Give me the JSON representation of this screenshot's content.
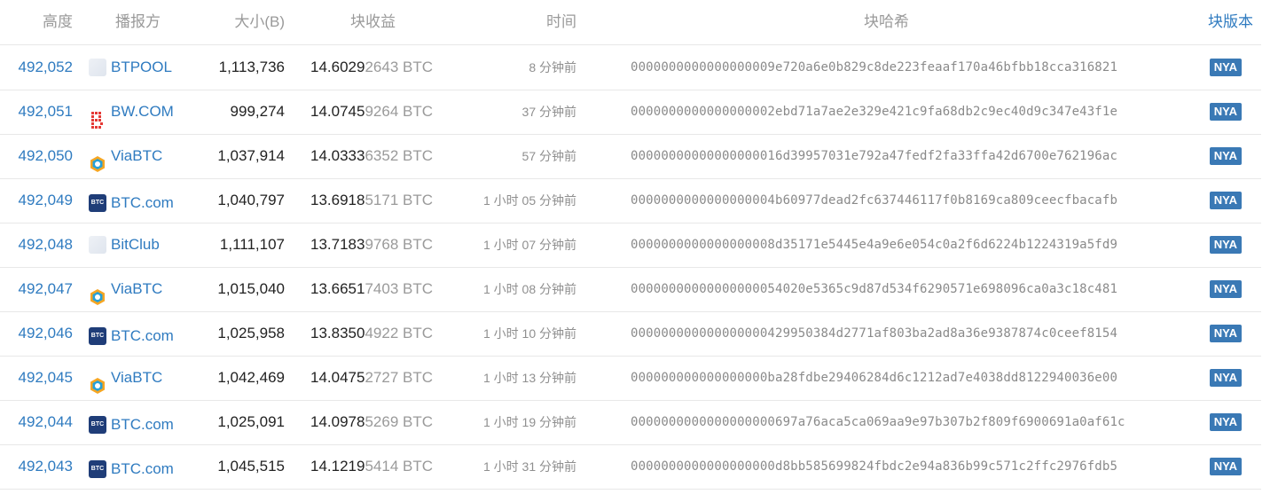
{
  "columns": {
    "height": "高度",
    "pool": "播报方",
    "size": "大小(B)",
    "reward": "块收益",
    "time": "时间",
    "hash": "块哈希",
    "version": "块版本"
  },
  "colors": {
    "link": "#2f7bc0",
    "badge": "#3a79b5"
  },
  "rows": [
    {
      "height": "492,052",
      "pool": "BTPOOL",
      "pool_icon": "blank-pool-icon",
      "size": "1,113,736",
      "reward_main": "14.6029",
      "reward_rest": "2643 BTC",
      "time": "8 分钟前",
      "hash": "0000000000000000009e720a6e0b829c8de223feaaf170a46bfbb18cca316821",
      "version": "NYA"
    },
    {
      "height": "492,051",
      "pool": "BW.COM",
      "pool_icon": "bw-icon",
      "size": "999,274",
      "reward_main": "14.0745",
      "reward_rest": "9264 BTC",
      "time": "37 分钟前",
      "hash": "0000000000000000002ebd71a7ae2e329e421c9fa68db2c9ec40d9c347e43f1e",
      "version": "NYA"
    },
    {
      "height": "492,050",
      "pool": "ViaBTC",
      "pool_icon": "viabtc-icon",
      "size": "1,037,914",
      "reward_main": "14.0333",
      "reward_rest": "6352 BTC",
      "time": "57 分钟前",
      "hash": "00000000000000000016d39957031e792a47fedf2fa33ffa42d6700e762196ac",
      "version": "NYA"
    },
    {
      "height": "492,049",
      "pool": "BTC.com",
      "pool_icon": "btccom-icon",
      "size": "1,040,797",
      "reward_main": "13.6918",
      "reward_rest": "5171 BTC",
      "time": "1 小时 05 分钟前",
      "hash": "0000000000000000004b60977dead2fc637446117f0b8169ca809ceecfbacafb",
      "version": "NYA"
    },
    {
      "height": "492,048",
      "pool": "BitClub",
      "pool_icon": "blank-pool-icon",
      "size": "1,111,107",
      "reward_main": "13.7183",
      "reward_rest": "9768 BTC",
      "time": "1 小时 07 分钟前",
      "hash": "0000000000000000008d35171e5445e4a9e6e054c0a2f6d6224b1224319a5fd9",
      "version": "NYA"
    },
    {
      "height": "492,047",
      "pool": "ViaBTC",
      "pool_icon": "viabtc-icon",
      "size": "1,015,040",
      "reward_main": "13.6651",
      "reward_rest": "7403 BTC",
      "time": "1 小时 08 分钟前",
      "hash": "00000000000000000054020e5365c9d87d534f6290571e698096ca0a3c18c481",
      "version": "NYA"
    },
    {
      "height": "492,046",
      "pool": "BTC.com",
      "pool_icon": "btccom-icon",
      "size": "1,025,958",
      "reward_main": "13.8350",
      "reward_rest": "4922 BTC",
      "time": "1 小时 10 分钟前",
      "hash": "000000000000000000429950384d2771af803ba2ad8a36e9387874c0ceef8154",
      "version": "NYA"
    },
    {
      "height": "492,045",
      "pool": "ViaBTC",
      "pool_icon": "viabtc-icon",
      "size": "1,042,469",
      "reward_main": "14.0475",
      "reward_rest": "2727 BTC",
      "time": "1 小时 13 分钟前",
      "hash": "000000000000000000ba28fdbe29406284d6c1212ad7e4038dd8122940036e00",
      "version": "NYA"
    },
    {
      "height": "492,044",
      "pool": "BTC.com",
      "pool_icon": "btccom-icon",
      "size": "1,025,091",
      "reward_main": "14.0978",
      "reward_rest": "5269 BTC",
      "time": "1 小时 19 分钟前",
      "hash": "0000000000000000000697a76aca5ca069aa9e97b307b2f809f6900691a0af61c",
      "version": "NYA"
    },
    {
      "height": "492,043",
      "pool": "BTC.com",
      "pool_icon": "btccom-icon",
      "size": "1,045,515",
      "reward_main": "14.1219",
      "reward_rest": "5414 BTC",
      "time": "1 小时 31 分钟前",
      "hash": "0000000000000000000d8bb585699824fbdc2e94a836b99c571c2ffc2976fdb5",
      "version": "NYA"
    }
  ]
}
